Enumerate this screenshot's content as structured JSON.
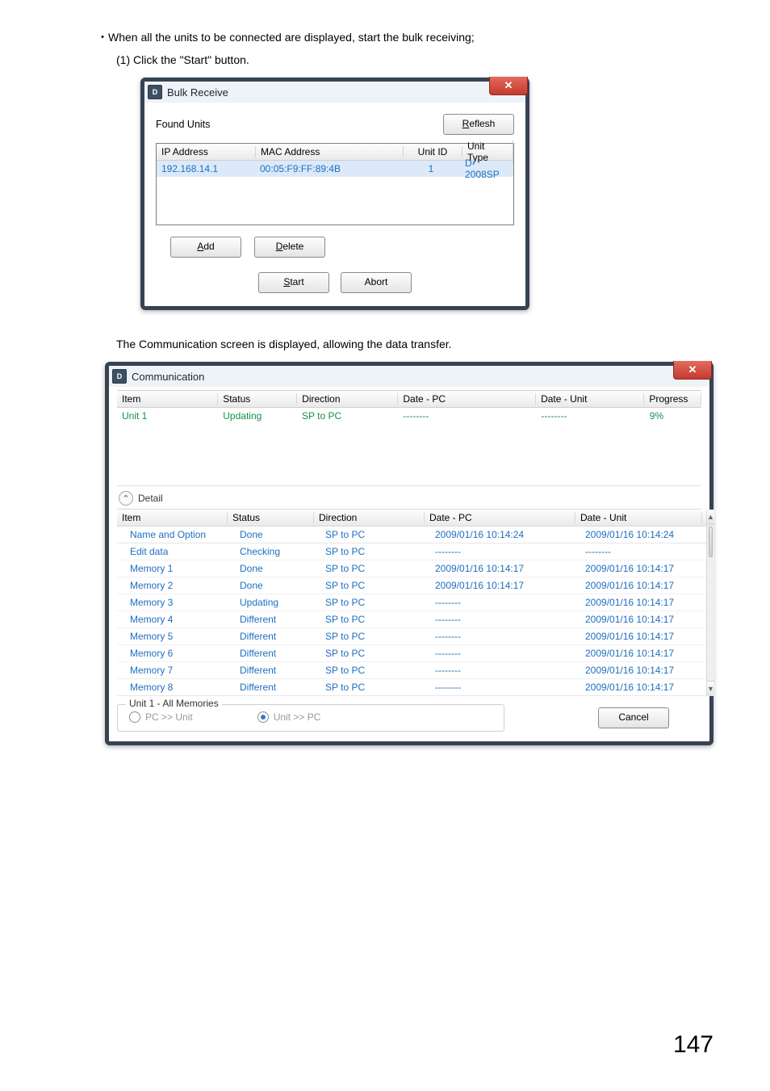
{
  "instructions": {
    "bullet": "・When all the units to be connected are displayed, start the bulk receiving;",
    "step": "(1) Click the \"Start\" button.",
    "note": "The Communication screen is displayed, allowing the data transfer."
  },
  "page_number": "147",
  "window1": {
    "title": "Bulk Receive",
    "close_glyph": "✕",
    "found_label": "Found Units",
    "btn_refresh_u": "R",
    "btn_refresh_rest": "eflesh",
    "headers": {
      "ip": "IP Address",
      "mac": "MAC Address",
      "uid": "Unit ID",
      "type": "Unit Type"
    },
    "row": {
      "ip": "192.168.14.1",
      "mac": "00:05:F9:FF:89:4B",
      "uid": "1",
      "type": "D-2008SP"
    },
    "btn_add_u": "A",
    "btn_add_rest": "dd",
    "btn_delete_u": "D",
    "btn_delete_rest": "elete",
    "btn_start_u": "S",
    "btn_start_rest": "tart",
    "btn_abort_u": "",
    "btn_abort_rest": "Abort"
  },
  "window2": {
    "title": "Communication",
    "close_glyph": "✕",
    "top_headers": {
      "item": "Item",
      "status": "Status",
      "direction": "Direction",
      "date_pc": "Date - PC",
      "date_unit": "Date - Unit",
      "progress": "Progress"
    },
    "top_row": {
      "item": "Unit 1",
      "status": "Updating",
      "direction": "SP to PC",
      "date_pc": "--------",
      "date_unit": "--------",
      "progress": "9%"
    },
    "detail_label": "Detail",
    "detail_headers": {
      "item": "Item",
      "status": "Status",
      "direction": "Direction",
      "date_pc": "Date - PC",
      "date_unit": "Date - Unit"
    },
    "detail_rows": [
      {
        "item": "Name and Option",
        "status": "Done",
        "direction": "SP to PC",
        "date_pc": "2009/01/16 10:14:24",
        "date_unit": "2009/01/16 10:14:24"
      },
      {
        "item": "Edit data",
        "status": "Checking",
        "direction": "SP to PC",
        "date_pc": "--------",
        "date_unit": "--------"
      },
      {
        "item": "Memory 1",
        "status": "Done",
        "direction": "SP to PC",
        "date_pc": "2009/01/16 10:14:17",
        "date_unit": "2009/01/16 10:14:17"
      },
      {
        "item": "Memory 2",
        "status": "Done",
        "direction": "SP to PC",
        "date_pc": "2009/01/16 10:14:17",
        "date_unit": "2009/01/16 10:14:17"
      },
      {
        "item": "Memory 3",
        "status": "Updating",
        "direction": "SP to PC",
        "date_pc": "--------",
        "date_unit": "2009/01/16 10:14:17"
      },
      {
        "item": "Memory 4",
        "status": "Different",
        "direction": "SP to PC",
        "date_pc": "--------",
        "date_unit": "2009/01/16 10:14:17"
      },
      {
        "item": "Memory 5",
        "status": "Different",
        "direction": "SP to PC",
        "date_pc": "--------",
        "date_unit": "2009/01/16 10:14:17"
      },
      {
        "item": "Memory 6",
        "status": "Different",
        "direction": "SP to PC",
        "date_pc": "--------",
        "date_unit": "2009/01/16 10:14:17"
      },
      {
        "item": "Memory 7",
        "status": "Different",
        "direction": "SP to PC",
        "date_pc": "--------",
        "date_unit": "2009/01/16 10:14:17"
      },
      {
        "item": "Memory 8",
        "status": "Different",
        "direction": "SP to PC",
        "date_pc": "--------",
        "date_unit": "2009/01/16 10:14:17"
      }
    ],
    "fieldset_legend": "Unit 1 - All Memories",
    "radio_pc_unit": "PC >> Unit",
    "radio_unit_pc": "Unit >> PC",
    "btn_cancel": "Cancel",
    "scroll_up": "▲",
    "scroll_down": "▼",
    "caret": "⌃"
  }
}
